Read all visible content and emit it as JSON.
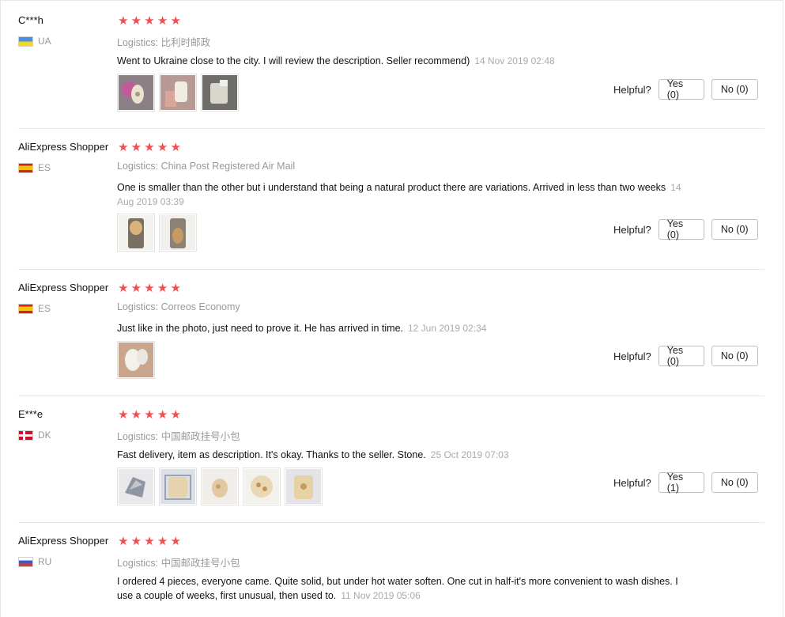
{
  "reviews": [
    {
      "user": "C***h",
      "country": "UA",
      "flag": "ua",
      "stars": 5,
      "logistics": "Logistics: 比利时邮政",
      "text": "Went to Ukraine close to the city. I will review the description. Seller recommend)",
      "date": "14 Nov 2019 02:48",
      "photos": 3,
      "helpful_label": "Helpful?",
      "yes": "Yes (0)",
      "no": "No (0)"
    },
    {
      "user": "AliExpress Shopper",
      "country": "ES",
      "flag": "es",
      "stars": 5,
      "logistics": "Logistics: China Post Registered Air Mail",
      "text": "One is smaller than the other but i understand that being a natural product there are variations. Arrived in less than two weeks",
      "date": "14 Aug 2019 03:39",
      "photos": 2,
      "helpful_label": "Helpful?",
      "yes": "Yes (0)",
      "no": "No (0)"
    },
    {
      "user": "AliExpress Shopper",
      "country": "ES",
      "flag": "es",
      "stars": 5,
      "logistics": "Logistics: Correos Economy",
      "text": "Just like in the photo, just need to prove it. He has arrived in time.",
      "date": "12 Jun 2019 02:34",
      "photos": 1,
      "helpful_label": "Helpful?",
      "yes": "Yes (0)",
      "no": "No (0)"
    },
    {
      "user": "E***e",
      "country": "DK",
      "flag": "dk",
      "stars": 5,
      "logistics": "Logistics: 中国邮政挂号小包",
      "text": "Fast delivery, item as description. It's okay. Thanks to the seller. Stone.",
      "date": "25 Oct 2019 07:03",
      "photos": 5,
      "helpful_label": "Helpful?",
      "yes": "Yes (1)",
      "no": "No (0)"
    },
    {
      "user": "AliExpress Shopper",
      "country": "RU",
      "flag": "ru",
      "stars": 5,
      "logistics": "Logistics: 中国邮政挂号小包",
      "text": "I ordered 4 pieces, everyone came. Quite solid, but under hot water soften. One cut in half-it's more convenient to wash dishes. I use a couple of weeks, first unusual, then used to.",
      "date": "11 Nov 2019 05:06",
      "photos": 0,
      "helpful_label": "",
      "yes": "",
      "no": ""
    }
  ],
  "colors": {
    "star": "#f05050",
    "muted": "#999999",
    "separator": "#e8e8e8"
  },
  "icons": {
    "star": "star-icon",
    "flag": "flag-icon"
  }
}
